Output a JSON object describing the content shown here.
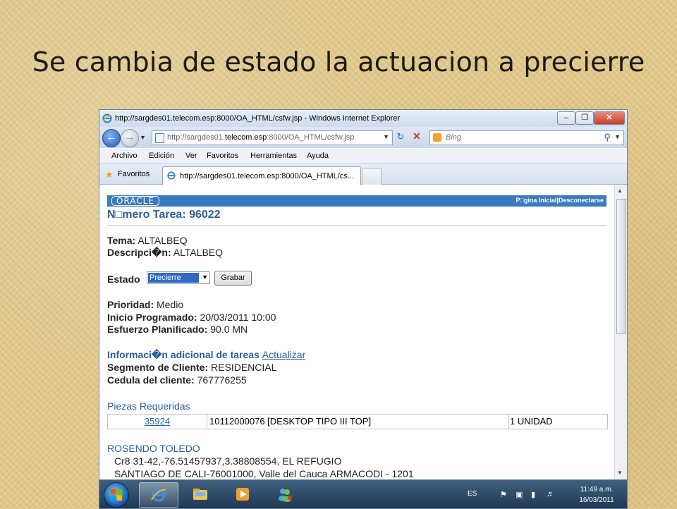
{
  "slide": {
    "title": "Se cambia de estado la actuacion a precierre"
  },
  "browser": {
    "window_title": "http://sargdes01.telecom.esp:8000/OA_HTML/csfw.jsp - Windows Internet Explorer",
    "address_url_prefix": "http://sargdes01.",
    "address_url_host": "telecom.esp",
    "address_url_suffix": ":8000/OA_HTML/csfw.jsp",
    "search_placeholder": "Bing",
    "menu": [
      "Archivo",
      "Edición",
      "Ver",
      "Favoritos",
      "Herramientas",
      "Ayuda"
    ],
    "favorites_label": "Favoritos",
    "tab_title": "http://sargdes01.telecom.esp:8000/OA_HTML/cs...",
    "win_min": "–",
    "win_max": "❐",
    "win_close": "✕"
  },
  "page": {
    "oracle_logo": "ORACLE",
    "header_links": "P□gina Inicial|Desconectarse",
    "task_title": "N□mero Tarea: 96022",
    "tema_label": "Tema:",
    "tema_value": "ALTALBEQ",
    "descripcion_label": "Descripci�n:",
    "descripcion_value": "ALTALBEQ",
    "estado_label": "Estado",
    "estado_value": "Precierre",
    "grabar_label": "Grabar",
    "prioridad_label": "Prioridad:",
    "prioridad_value": "Medio",
    "inicio_label": "Inicio Programado:",
    "inicio_value": "20/03/2011 10:00",
    "esfuerzo_label": "Esfuerzo Planificado:",
    "esfuerzo_value": "90.0 MN",
    "info_heading": "Informaci�n adicional de tareas",
    "actualizar_link": "Actualizar",
    "segmento_label": "Segmento de Cliente:",
    "segmento_value": "RESIDENCIAL",
    "cedula_label": "Cedula del cliente:",
    "cedula_value": "767776255",
    "piezas_heading": "Piezas Requeridas",
    "piezas": [
      {
        "code": "35924",
        "description": "10112000076 [DESKTOP TIPO III TOP]",
        "quantity": "1 UNIDAD"
      }
    ],
    "contact_name": "ROSENDO TOLEDO",
    "address_line1": "Cr8 31-42,-76.51457937,3.38808554, EL REFUGIO",
    "address_line2": "SANTIAGO DE CALI-76001000, Valle del Cauca ARMACODI - 1201"
  },
  "taskbar": {
    "language": "ES",
    "time": "11:49 a.m.",
    "date": "16/03/2011"
  }
}
